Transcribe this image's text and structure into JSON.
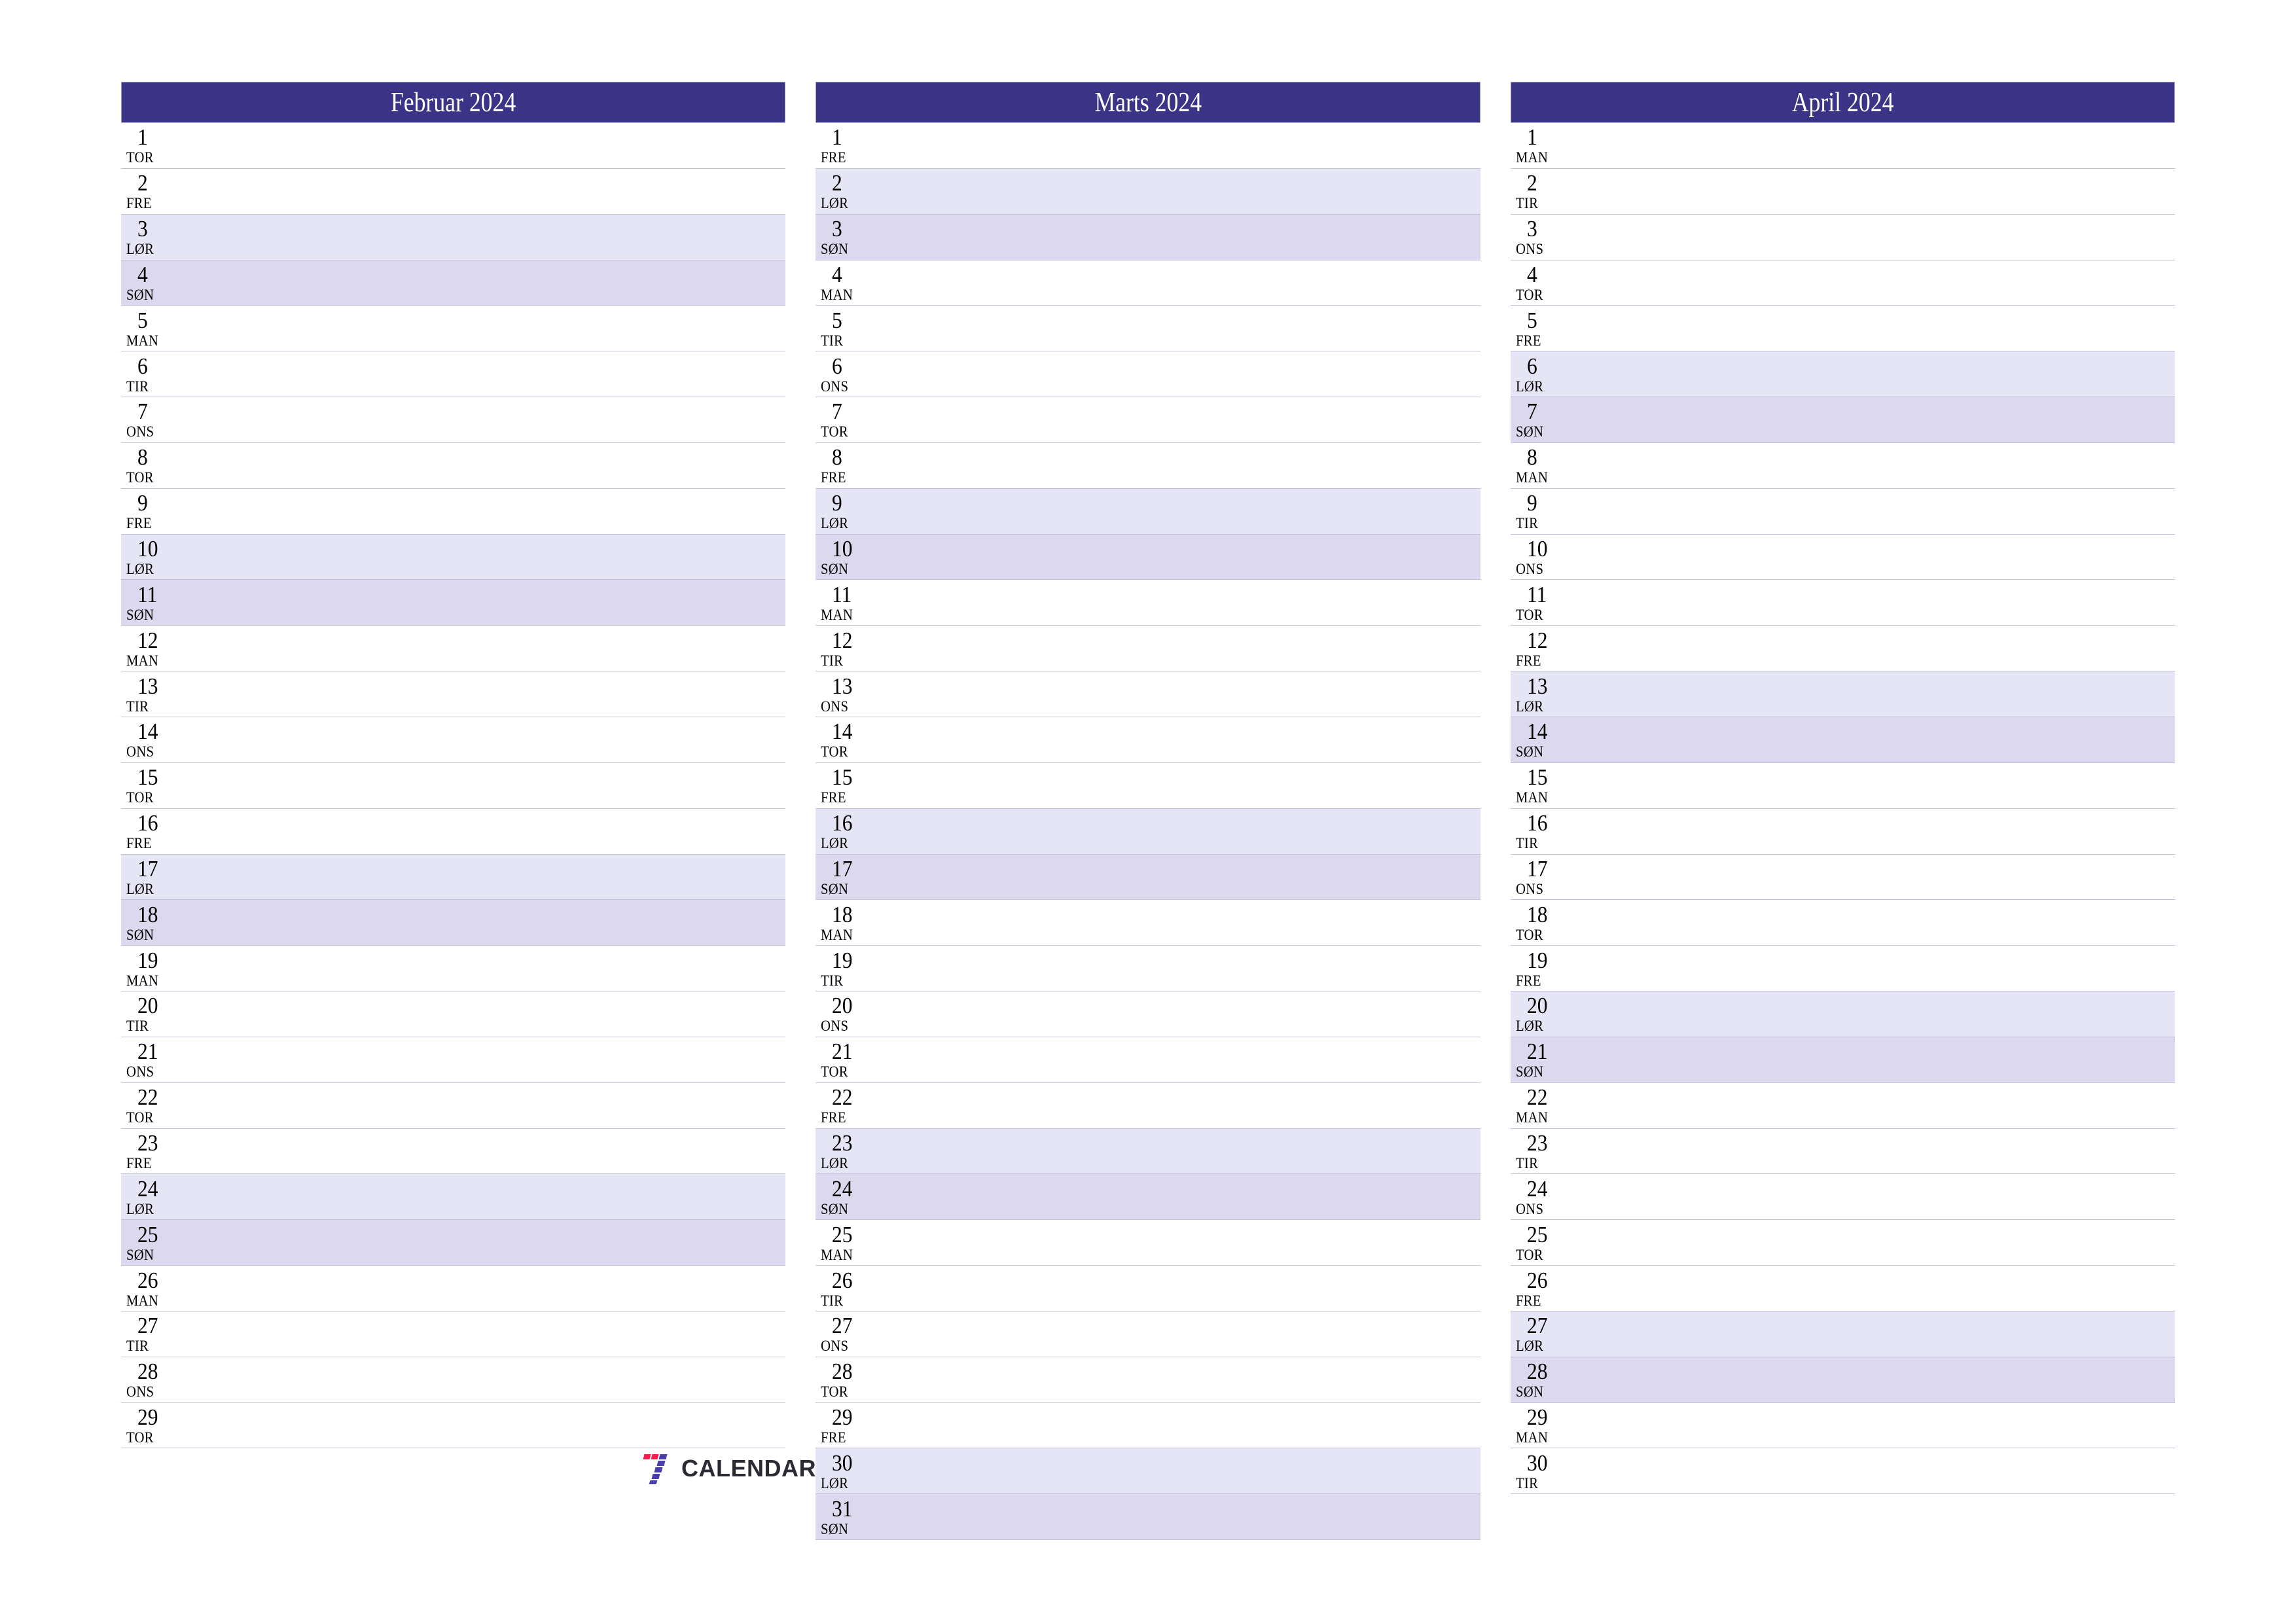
{
  "document": {
    "type": "printable-calendar",
    "orientation": "landscape",
    "year": "2024",
    "locale_weekday_abbrs": [
      "MAN",
      "TIR",
      "ONS",
      "TOR",
      "FRE",
      "LØR",
      "SØN"
    ]
  },
  "colors": {
    "header_background": "#3a3386",
    "header_text": "#ffffff",
    "saturday_background": "#e5e5f5",
    "sunday_background": "#dcd8ed",
    "weekday_background": "#ffffff",
    "row_separator": "#c3c1dc",
    "day_text": "#000000",
    "logo_red": "#f4204f",
    "logo_purple": "#4a3fa8",
    "logo_word": "#2b2b33"
  },
  "brand": {
    "mark_name": "seven-logo-icon",
    "word": "CALENDAR"
  },
  "months": [
    {
      "title": "Februar 2024",
      "days": [
        {
          "number": "1",
          "weekday": "TOR",
          "kind": "weekday"
        },
        {
          "number": "2",
          "weekday": "FRE",
          "kind": "weekday"
        },
        {
          "number": "3",
          "weekday": "LØR",
          "kind": "saturday"
        },
        {
          "number": "4",
          "weekday": "SØN",
          "kind": "sunday"
        },
        {
          "number": "5",
          "weekday": "MAN",
          "kind": "weekday"
        },
        {
          "number": "6",
          "weekday": "TIR",
          "kind": "weekday"
        },
        {
          "number": "7",
          "weekday": "ONS",
          "kind": "weekday"
        },
        {
          "number": "8",
          "weekday": "TOR",
          "kind": "weekday"
        },
        {
          "number": "9",
          "weekday": "FRE",
          "kind": "weekday"
        },
        {
          "number": "10",
          "weekday": "LØR",
          "kind": "saturday"
        },
        {
          "number": "11",
          "weekday": "SØN",
          "kind": "sunday"
        },
        {
          "number": "12",
          "weekday": "MAN",
          "kind": "weekday"
        },
        {
          "number": "13",
          "weekday": "TIR",
          "kind": "weekday"
        },
        {
          "number": "14",
          "weekday": "ONS",
          "kind": "weekday"
        },
        {
          "number": "15",
          "weekday": "TOR",
          "kind": "weekday"
        },
        {
          "number": "16",
          "weekday": "FRE",
          "kind": "weekday"
        },
        {
          "number": "17",
          "weekday": "LØR",
          "kind": "saturday"
        },
        {
          "number": "18",
          "weekday": "SØN",
          "kind": "sunday"
        },
        {
          "number": "19",
          "weekday": "MAN",
          "kind": "weekday"
        },
        {
          "number": "20",
          "weekday": "TIR",
          "kind": "weekday"
        },
        {
          "number": "21",
          "weekday": "ONS",
          "kind": "weekday"
        },
        {
          "number": "22",
          "weekday": "TOR",
          "kind": "weekday"
        },
        {
          "number": "23",
          "weekday": "FRE",
          "kind": "weekday"
        },
        {
          "number": "24",
          "weekday": "LØR",
          "kind": "saturday"
        },
        {
          "number": "25",
          "weekday": "SØN",
          "kind": "sunday"
        },
        {
          "number": "26",
          "weekday": "MAN",
          "kind": "weekday"
        },
        {
          "number": "27",
          "weekday": "TIR",
          "kind": "weekday"
        },
        {
          "number": "28",
          "weekday": "ONS",
          "kind": "weekday"
        },
        {
          "number": "29",
          "weekday": "TOR",
          "kind": "weekday"
        }
      ]
    },
    {
      "title": "Marts 2024",
      "days": [
        {
          "number": "1",
          "weekday": "FRE",
          "kind": "weekday"
        },
        {
          "number": "2",
          "weekday": "LØR",
          "kind": "saturday"
        },
        {
          "number": "3",
          "weekday": "SØN",
          "kind": "sunday"
        },
        {
          "number": "4",
          "weekday": "MAN",
          "kind": "weekday"
        },
        {
          "number": "5",
          "weekday": "TIR",
          "kind": "weekday"
        },
        {
          "number": "6",
          "weekday": "ONS",
          "kind": "weekday"
        },
        {
          "number": "7",
          "weekday": "TOR",
          "kind": "weekday"
        },
        {
          "number": "8",
          "weekday": "FRE",
          "kind": "weekday"
        },
        {
          "number": "9",
          "weekday": "LØR",
          "kind": "saturday"
        },
        {
          "number": "10",
          "weekday": "SØN",
          "kind": "sunday"
        },
        {
          "number": "11",
          "weekday": "MAN",
          "kind": "weekday"
        },
        {
          "number": "12",
          "weekday": "TIR",
          "kind": "weekday"
        },
        {
          "number": "13",
          "weekday": "ONS",
          "kind": "weekday"
        },
        {
          "number": "14",
          "weekday": "TOR",
          "kind": "weekday"
        },
        {
          "number": "15",
          "weekday": "FRE",
          "kind": "weekday"
        },
        {
          "number": "16",
          "weekday": "LØR",
          "kind": "saturday"
        },
        {
          "number": "17",
          "weekday": "SØN",
          "kind": "sunday"
        },
        {
          "number": "18",
          "weekday": "MAN",
          "kind": "weekday"
        },
        {
          "number": "19",
          "weekday": "TIR",
          "kind": "weekday"
        },
        {
          "number": "20",
          "weekday": "ONS",
          "kind": "weekday"
        },
        {
          "number": "21",
          "weekday": "TOR",
          "kind": "weekday"
        },
        {
          "number": "22",
          "weekday": "FRE",
          "kind": "weekday"
        },
        {
          "number": "23",
          "weekday": "LØR",
          "kind": "saturday"
        },
        {
          "number": "24",
          "weekday": "SØN",
          "kind": "sunday"
        },
        {
          "number": "25",
          "weekday": "MAN",
          "kind": "weekday"
        },
        {
          "number": "26",
          "weekday": "TIR",
          "kind": "weekday"
        },
        {
          "number": "27",
          "weekday": "ONS",
          "kind": "weekday"
        },
        {
          "number": "28",
          "weekday": "TOR",
          "kind": "weekday"
        },
        {
          "number": "29",
          "weekday": "FRE",
          "kind": "weekday"
        },
        {
          "number": "30",
          "weekday": "LØR",
          "kind": "saturday"
        },
        {
          "number": "31",
          "weekday": "SØN",
          "kind": "sunday"
        }
      ]
    },
    {
      "title": "April 2024",
      "days": [
        {
          "number": "1",
          "weekday": "MAN",
          "kind": "weekday"
        },
        {
          "number": "2",
          "weekday": "TIR",
          "kind": "weekday"
        },
        {
          "number": "3",
          "weekday": "ONS",
          "kind": "weekday"
        },
        {
          "number": "4",
          "weekday": "TOR",
          "kind": "weekday"
        },
        {
          "number": "5",
          "weekday": "FRE",
          "kind": "weekday"
        },
        {
          "number": "6",
          "weekday": "LØR",
          "kind": "saturday"
        },
        {
          "number": "7",
          "weekday": "SØN",
          "kind": "sunday"
        },
        {
          "number": "8",
          "weekday": "MAN",
          "kind": "weekday"
        },
        {
          "number": "9",
          "weekday": "TIR",
          "kind": "weekday"
        },
        {
          "number": "10",
          "weekday": "ONS",
          "kind": "weekday"
        },
        {
          "number": "11",
          "weekday": "TOR",
          "kind": "weekday"
        },
        {
          "number": "12",
          "weekday": "FRE",
          "kind": "weekday"
        },
        {
          "number": "13",
          "weekday": "LØR",
          "kind": "saturday"
        },
        {
          "number": "14",
          "weekday": "SØN",
          "kind": "sunday"
        },
        {
          "number": "15",
          "weekday": "MAN",
          "kind": "weekday"
        },
        {
          "number": "16",
          "weekday": "TIR",
          "kind": "weekday"
        },
        {
          "number": "17",
          "weekday": "ONS",
          "kind": "weekday"
        },
        {
          "number": "18",
          "weekday": "TOR",
          "kind": "weekday"
        },
        {
          "number": "19",
          "weekday": "FRE",
          "kind": "weekday"
        },
        {
          "number": "20",
          "weekday": "LØR",
          "kind": "saturday"
        },
        {
          "number": "21",
          "weekday": "SØN",
          "kind": "sunday"
        },
        {
          "number": "22",
          "weekday": "MAN",
          "kind": "weekday"
        },
        {
          "number": "23",
          "weekday": "TIR",
          "kind": "weekday"
        },
        {
          "number": "24",
          "weekday": "ONS",
          "kind": "weekday"
        },
        {
          "number": "25",
          "weekday": "TOR",
          "kind": "weekday"
        },
        {
          "number": "26",
          "weekday": "FRE",
          "kind": "weekday"
        },
        {
          "number": "27",
          "weekday": "LØR",
          "kind": "saturday"
        },
        {
          "number": "28",
          "weekday": "SØN",
          "kind": "sunday"
        },
        {
          "number": "29",
          "weekday": "MAN",
          "kind": "weekday"
        },
        {
          "number": "30",
          "weekday": "TIR",
          "kind": "weekday"
        }
      ]
    }
  ]
}
